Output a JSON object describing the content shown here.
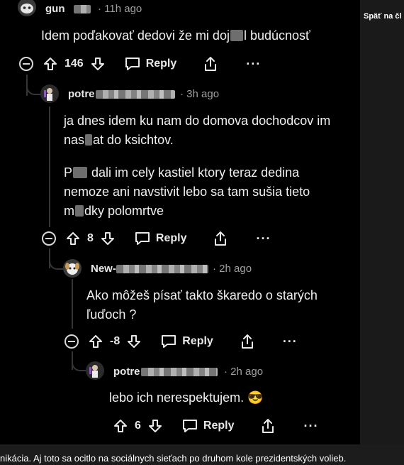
{
  "side_panel": {
    "back_label": "Späť na čl"
  },
  "caption": "nikácia. Aj toto sa ocitlo na sociálnych sieťach po druhom kole prezidentských volieb.",
  "comments": [
    {
      "username": "gun",
      "timestamp": "· 11h ago",
      "body_parts": [
        "Idem poďakovať dedovi že mi doj",
        "l budúcnosť"
      ],
      "score": "146",
      "reply_label": "Reply",
      "more_label": "···"
    },
    {
      "username": "potre",
      "timestamp": "· 3h ago",
      "para1_lines": [
        "ja dnes idem ku nam do domova dochodcov im",
        "nas",
        "at do ksichtov."
      ],
      "para2": [
        "P",
        "dali im cely kastiel ktory teraz dedina",
        "nemoze ani navstivit lebo sa tam sušia tieto",
        "m",
        "dky polomrtve"
      ],
      "score": "8",
      "reply_label": "Reply",
      "more_label": "···"
    },
    {
      "username": "New-",
      "timestamp": "· 2h ago",
      "body_lines": [
        "Ako môžeš písať takto škaredo o starých",
        "ľuďoch ?"
      ],
      "score": "-8",
      "reply_label": "Reply",
      "more_label": "···"
    },
    {
      "username": "potre",
      "timestamp": "· 2h ago",
      "body": "lebo ich nerespektujem.",
      "emoji": "😎",
      "score": "6",
      "reply_label": "Reply",
      "more_label": "···"
    }
  ]
}
